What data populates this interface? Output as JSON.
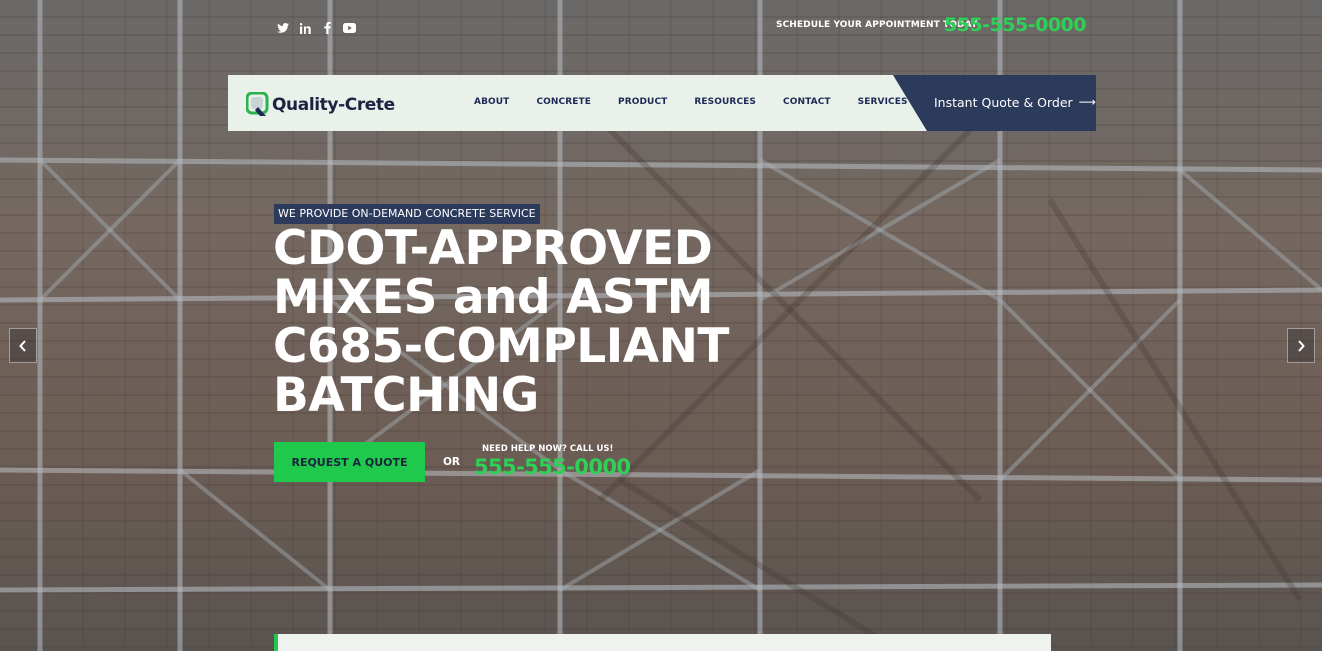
{
  "topbar": {
    "social_icons": [
      "twitter-icon",
      "linkedin-icon",
      "facebook-icon",
      "youtube-icon"
    ],
    "schedule_text": "SCHEDULE YOUR APPOINTMENT TODAY",
    "phone": "555-555-0000"
  },
  "header": {
    "logo_text": "Quality-Crete",
    "nav": [
      "ABOUT",
      "CONCRETE",
      "PRODUCT",
      "RESOURCES",
      "CONTACT",
      "SERVICES"
    ],
    "cta_label": "Instant Quote & Order",
    "cta_arrow": "⟶"
  },
  "hero": {
    "tagline": "WE PROVIDE ON-DEMAND CONCRETE SERVICE",
    "headline_lines": [
      "CDOT-APPROVED",
      "MIXES and ASTM",
      "C685-COMPLIANT",
      "BATCHING"
    ],
    "request_button": "REQUEST A QUOTE",
    "or_text": "OR",
    "need_help": "NEED HELP NOW? CALL US!",
    "phone": "555-555-0000"
  },
  "slider": {
    "prev_icon": "chevron-left-icon",
    "next_icon": "chevron-right-icon"
  },
  "colors": {
    "accent_green": "#1fc94b",
    "phone_green": "#2ed155",
    "navy": "#2c3a5c",
    "header_bg": "#e9f1ea"
  }
}
